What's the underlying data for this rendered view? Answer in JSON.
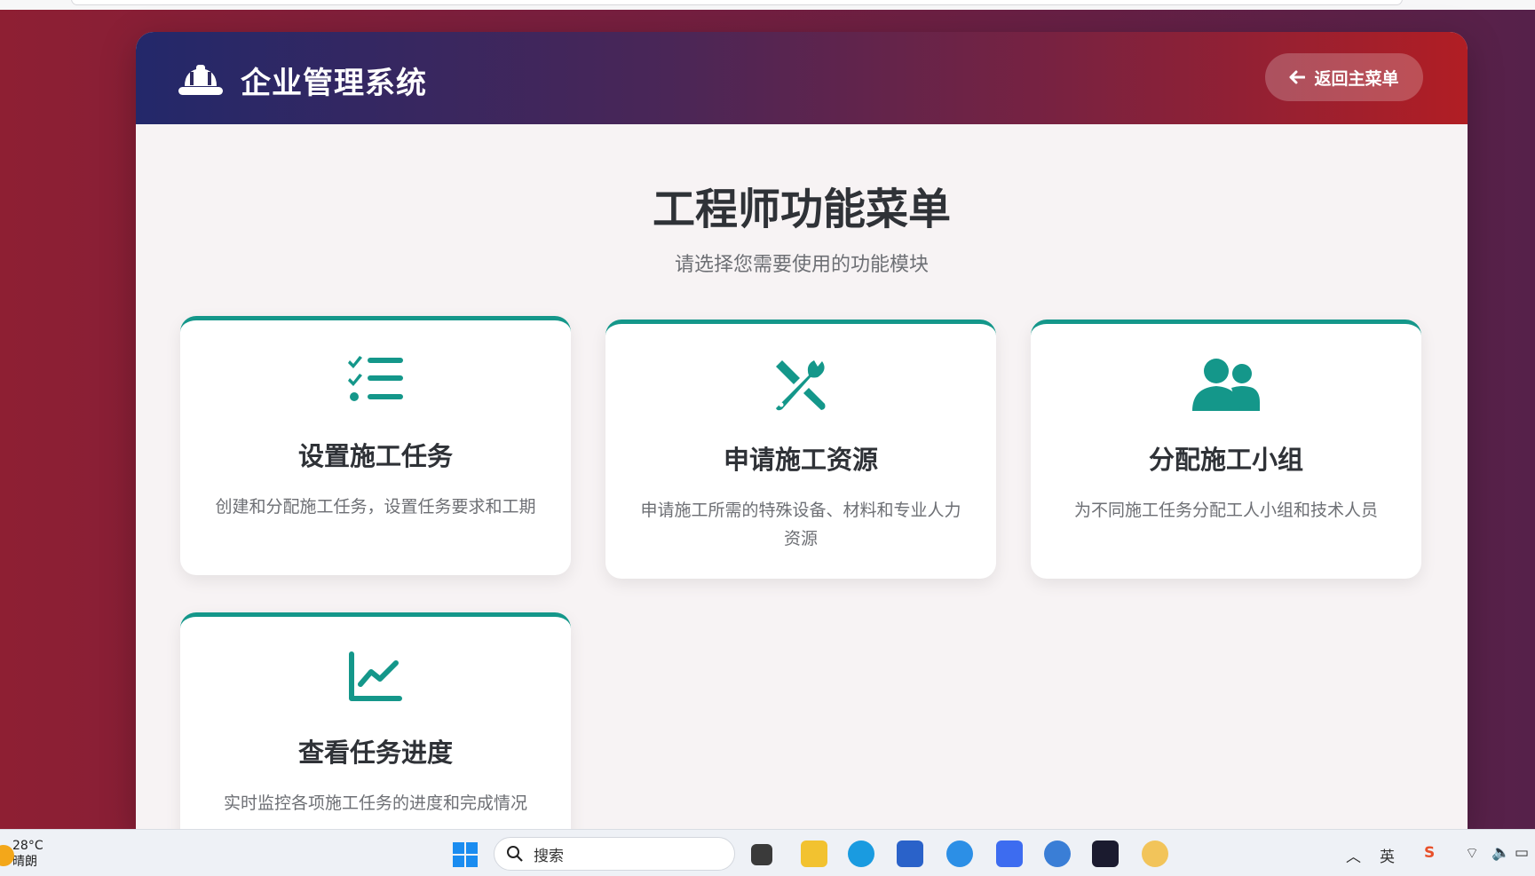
{
  "app": {
    "brand": "企业管理系统",
    "back_button": "返回主菜单"
  },
  "page": {
    "title": "工程师功能菜单",
    "subtitle": "请选择您需要使用的功能模块"
  },
  "cards": [
    {
      "icon": "task-list-icon",
      "title": "设置施工任务",
      "desc": "创建和分配施工任务，设置任务要求和工期"
    },
    {
      "icon": "tools-icon",
      "title": "申请施工资源",
      "desc": "申请施工所需的特殊设备、材料和专业人力资源"
    },
    {
      "icon": "users-icon",
      "title": "分配施工小组",
      "desc": "为不同施工任务分配工人小组和技术人员"
    },
    {
      "icon": "chart-line-icon",
      "title": "查看任务进度",
      "desc": "实时监控各项施工任务的进度和完成情况"
    }
  ],
  "colors": {
    "accent": "#14978a",
    "header_left": "#23286a",
    "header_right": "#b11e24"
  },
  "taskbar": {
    "temperature": "28°C",
    "weather": "晴朗",
    "search_placeholder": "搜索",
    "ime": "英"
  }
}
